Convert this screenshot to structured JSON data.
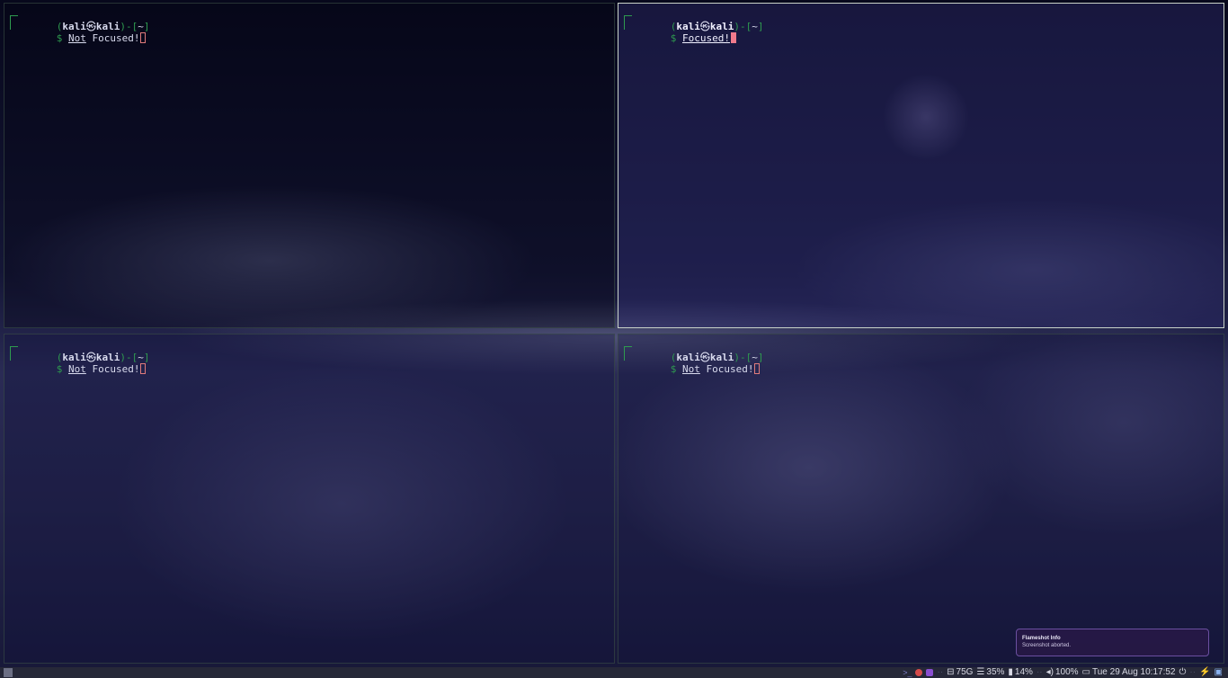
{
  "terminals": [
    {
      "id": "top-left",
      "focused": false,
      "prompt": {
        "user": "kali",
        "at": "㉿",
        "host": "kali",
        "path": "~"
      },
      "dollar": "$",
      "command_u": "Not",
      "command_rest": " Focused!"
    },
    {
      "id": "top-right",
      "focused": true,
      "prompt": {
        "user": "kali",
        "at": "㉿",
        "host": "kali",
        "path": "~"
      },
      "dollar": "$",
      "command_u": "Focused!",
      "command_rest": ""
    },
    {
      "id": "bottom-left",
      "focused": false,
      "prompt": {
        "user": "kali",
        "at": "㉿",
        "host": "kali",
        "path": "~"
      },
      "dollar": "$",
      "command_u": "Not",
      "command_rest": " Focused!"
    },
    {
      "id": "bottom-right",
      "focused": false,
      "prompt": {
        "user": "kali",
        "at": "㉿",
        "host": "kali",
        "path": "~"
      },
      "dollar": "$",
      "command_u": "Not",
      "command_rest": " Focused!"
    }
  ],
  "notification": {
    "title": "Flameshot Info",
    "body": "Screenshot aborted."
  },
  "taskbar": {
    "disk": "75G",
    "memory": "35%",
    "battery": "14%",
    "volume": "100%",
    "datetime": "Tue 29 Aug 10:17:52",
    "icons": [
      "terminal-icon",
      "kali-icon",
      "app-icon",
      "disk-icon",
      "memory-icon",
      "battery-icon",
      "volume-icon",
      "keyboard-icon",
      "power-icon",
      "network-icon",
      "display-icon"
    ]
  },
  "colors": {
    "prompt_green": "#2e9b4f",
    "cursor_focused": "#f07a8c",
    "cursor_unfocused": "#e07b7b",
    "focused_border": "#c9d3c9",
    "notification_border": "#6b4fa0"
  }
}
